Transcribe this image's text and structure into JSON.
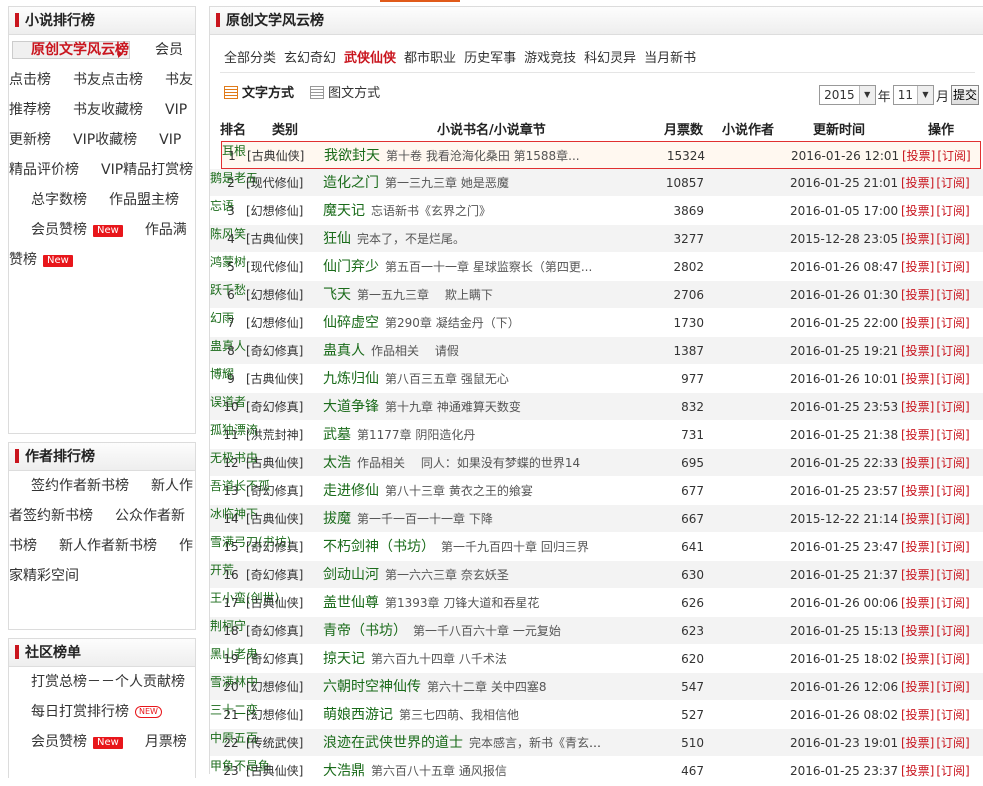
{
  "sidebar": {
    "novel_rank": {
      "title": "小说排行榜",
      "items": [
        {
          "label": "原创文学风云榜",
          "active": true
        },
        {
          "label": "会员点击榜"
        },
        {
          "label": "书友点击榜"
        },
        {
          "label": "书友推荐榜"
        },
        {
          "label": "书友收藏榜"
        },
        {
          "label": "VIP更新榜"
        },
        {
          "label": "VIP收藏榜"
        },
        {
          "label": "VIP精品评价榜"
        },
        {
          "label": "VIP精品打赏榜"
        },
        {
          "label": "总字数榜"
        },
        {
          "label": "作品盟主榜"
        },
        {
          "label": "会员赞榜",
          "badge": "New"
        },
        {
          "label": "作品满赞榜",
          "badge": "New"
        }
      ]
    },
    "author_rank": {
      "title": "作者排行榜",
      "items": [
        {
          "label": "签约作者新书榜"
        },
        {
          "label": "新人作者签约新书榜"
        },
        {
          "label": "公众作者新书榜"
        },
        {
          "label": "新人作者新书榜"
        },
        {
          "label": "作家精彩空间"
        }
      ]
    },
    "community_rank": {
      "title": "社区榜单",
      "items": [
        {
          "label": "打赏总榜－－个人贡献榜"
        },
        {
          "label": "每日打赏排行榜",
          "badge2": "NEW"
        },
        {
          "label": "会员赞榜",
          "badge": "New"
        },
        {
          "label": "月票榜"
        }
      ]
    }
  },
  "main": {
    "title": "原创文学风云榜",
    "tabs": [
      "全部分类",
      "玄幻奇幻",
      "武侠仙侠",
      "都市职业",
      "历史军事",
      "游戏竞技",
      "科幻灵异",
      "当月新书"
    ],
    "active_tab": "武侠仙侠",
    "modes": {
      "text": "文字方式",
      "image": "图文方式"
    },
    "year": "2015",
    "year_label": "年",
    "month": "11",
    "month_label": "月",
    "submit": "提交",
    "headers": {
      "rank": "排名",
      "category": "类别",
      "title": "小说书名/小说章节",
      "votes": "月票数",
      "author": "小说作者",
      "time": "更新时间",
      "op": "操作"
    },
    "op_vote": "[投票]",
    "op_sub": "[订阅]",
    "rows": [
      {
        "rank": "1",
        "cat": "[古典仙侠]",
        "book": "我欲封天",
        "chapter": "第十卷 我看沧海化桑田 第1588章...",
        "votes": "15324",
        "author": "耳根",
        "time": "2016-01-26 12:01"
      },
      {
        "rank": "2",
        "cat": "[现代修仙]",
        "book": "造化之门",
        "chapter": "第一三九三章 她是恶魔",
        "votes": "10857",
        "author": "鹅是老五",
        "time": "2016-01-25 21:01"
      },
      {
        "rank": "3",
        "cat": "[幻想修仙]",
        "book": "魔天记",
        "chapter": "忘语新书《玄界之门》",
        "votes": "3869",
        "author": "忘语",
        "time": "2016-01-05 17:00"
      },
      {
        "rank": "4",
        "cat": "[古典仙侠]",
        "book": "狂仙",
        "chapter": "完本了，不是烂尾。",
        "votes": "3277",
        "author": "陈风笑",
        "time": "2015-12-28 23:05"
      },
      {
        "rank": "5",
        "cat": "[现代修仙]",
        "book": "仙门弃少",
        "chapter": "第五百一十一章 星球监察长（第四更...",
        "votes": "2802",
        "author": "鸿蒙树",
        "time": "2016-01-26 08:47"
      },
      {
        "rank": "6",
        "cat": "[幻想修仙]",
        "book": "飞天",
        "chapter": "第一五九三章 　欺上瞒下",
        "votes": "2706",
        "author": "跃千愁",
        "time": "2016-01-26 01:30"
      },
      {
        "rank": "7",
        "cat": "[幻想修仙]",
        "book": "仙碎虚空",
        "chapter": "第290章 凝结金丹（下）",
        "votes": "1730",
        "author": "幻雨",
        "time": "2016-01-25 22:00"
      },
      {
        "rank": "8",
        "cat": "[奇幻修真]",
        "book": "蛊真人",
        "chapter": "作品相关 　请假",
        "votes": "1387",
        "author": "蛊真人",
        "time": "2016-01-25 19:21"
      },
      {
        "rank": "9",
        "cat": "[古典仙侠]",
        "book": "九炼归仙",
        "chapter": "第八百三五章 强鼠无心",
        "votes": "977",
        "author": "博耀",
        "time": "2016-01-26 10:01"
      },
      {
        "rank": "10",
        "cat": "[奇幻修真]",
        "book": "大道争锋",
        "chapter": "第十九章 神通难算天数变",
        "votes": "832",
        "author": "误道者",
        "time": "2016-01-25 23:53"
      },
      {
        "rank": "11",
        "cat": "[洪荒封神]",
        "book": "武墓",
        "chapter": "第1177章 阴阳造化丹",
        "votes": "731",
        "author": "孤独漂流",
        "time": "2016-01-25 21:38"
      },
      {
        "rank": "12",
        "cat": "[古典仙侠]",
        "book": "太浩",
        "chapter": "作品相关 　同人：如果没有梦蝶的世界14",
        "votes": "695",
        "author": "无极书虫",
        "time": "2016-01-25 22:33"
      },
      {
        "rank": "13",
        "cat": "[奇幻修真]",
        "book": "走进修仙",
        "chapter": "第八十三章 黄衣之王的飨宴",
        "votes": "677",
        "author": "吾道长不孤",
        "time": "2016-01-25 23:57"
      },
      {
        "rank": "14",
        "cat": "[古典仙侠]",
        "book": "拔魔",
        "chapter": "第一千一百一十一章 下降",
        "votes": "667",
        "author": "冰临神下",
        "time": "2015-12-22 21:14"
      },
      {
        "rank": "15",
        "cat": "[奇幻修真]",
        "book": "不朽剑神（书坊）",
        "chapter": "第一千九百四十章 回归三界",
        "votes": "641",
        "author": "雪满弓刀(书坊)",
        "time": "2016-01-25 23:47"
      },
      {
        "rank": "16",
        "cat": "[奇幻修真]",
        "book": "剑动山河",
        "chapter": "第一六六三章 奈玄妖圣",
        "votes": "630",
        "author": "开荒",
        "time": "2016-01-25 21:37"
      },
      {
        "rank": "17",
        "cat": "[古典仙侠]",
        "book": "盖世仙尊",
        "chapter": "第1393章 刀锋大道和吞星花",
        "votes": "626",
        "author": "王小蛮(创世)",
        "time": "2016-01-26 00:06"
      },
      {
        "rank": "18",
        "cat": "[奇幻修真]",
        "book": "青帝（书坊）",
        "chapter": "第一千八百六十章 一元复始",
        "votes": "623",
        "author": "荆柯守",
        "time": "2016-01-25 15:13"
      },
      {
        "rank": "19",
        "cat": "[奇幻修真]",
        "book": "掠天记",
        "chapter": "第六百九十四章 八千术法",
        "votes": "620",
        "author": "黑山老鬼",
        "time": "2016-01-25 18:02"
      },
      {
        "rank": "20",
        "cat": "[幻想修仙]",
        "book": "六朝时空神仙传",
        "chapter": "第六十二章 关中四塞8",
        "votes": "547",
        "author": "雪满林中",
        "time": "2016-01-26 12:06"
      },
      {
        "rank": "21",
        "cat": "[幻想修仙]",
        "book": "萌娘西游记",
        "chapter": "第三七四萌、我相信他",
        "votes": "527",
        "author": "三十二变",
        "time": "2016-01-26 08:02"
      },
      {
        "rank": "22",
        "cat": "[传统武侠]",
        "book": "浪迹在武侠世界的道士",
        "chapter": "完本感言，新书《青玄道主...",
        "votes": "510",
        "author": "中原五百",
        "time": "2016-01-23 19:01"
      },
      {
        "rank": "23",
        "cat": "[古典仙侠]",
        "book": "大浩鼎",
        "chapter": "第六百八十五章 通风报信",
        "votes": "467",
        "author": "甲鱼不是鱼",
        "time": "2016-01-25 23:37"
      }
    ]
  }
}
